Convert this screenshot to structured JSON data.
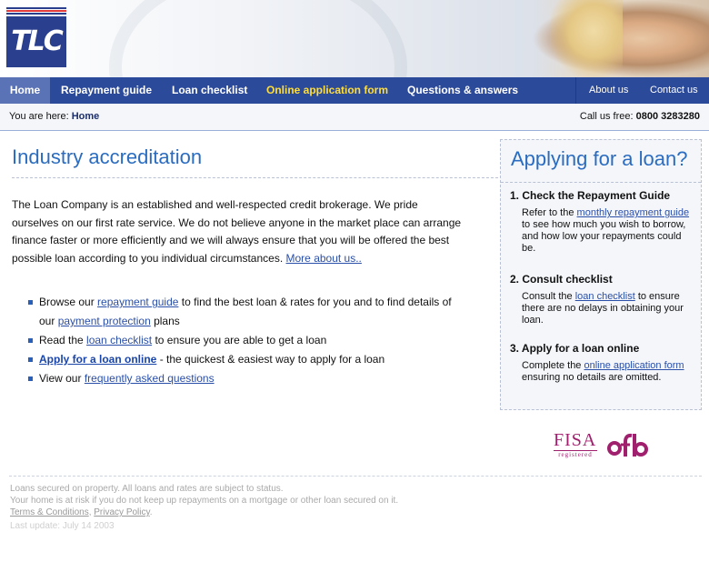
{
  "header": {
    "logo_text": "TLC",
    "logo_stripe_colors": [
      "#2a3f8e",
      "#e23b3b",
      "#2a3f8e"
    ]
  },
  "nav": {
    "home": "Home",
    "repayment": "Repayment guide",
    "checklist": "Loan checklist",
    "online": "Online application form",
    "qa": "Questions & answers",
    "about": "About us",
    "contact": "Contact us"
  },
  "breadcrumb": {
    "prefix": "You are here:",
    "current": "Home"
  },
  "call": {
    "label": "Call us free:",
    "number": "0800 3283280"
  },
  "main": {
    "title": "Industry accreditation",
    "intro": "The Loan Company is an established and well-respected credit brokerage. We pride ourselves on our first rate service. We do not believe anyone in the market place can arrange finance faster or more efficiently and we will always ensure that you will be offered the best possible loan according to you individual circumstances.",
    "more_link": "More about us..",
    "bullets": {
      "b1_pre": "Browse our",
      "b1_link1": "repayment guide",
      "b1_mid": "to find the best loan & rates for you and to find details of our",
      "b1_link2": "payment protection",
      "b1_post": "plans",
      "b2_pre": "Read the",
      "b2_link": "loan checklist",
      "b2_post": "to ensure you are able to get a loan",
      "b3_link": "Apply for a loan online",
      "b3_post": "- the quickest & easiest way to apply for a loan",
      "b4_pre": "View our",
      "b4_link": "frequently asked questions"
    }
  },
  "sidebar": {
    "title": "Applying for a loan?",
    "steps": [
      {
        "num": "1.",
        "heading": "Check the Repayment Guide",
        "pre": "Refer to the",
        "link": "monthly repayment guide",
        "post": "to see how much you wish to borrow, and how low your repayments could be."
      },
      {
        "num": "2.",
        "heading": "Consult checklist",
        "pre": "Consult the",
        "link": "loan checklist",
        "post": "to ensure there are no delays in obtaining your loan."
      },
      {
        "num": "3.",
        "heading": "Apply for a loan online",
        "pre": "Complete the",
        "link": "online application form",
        "post": "ensuring no details are omitted."
      }
    ]
  },
  "badges": {
    "fisa_big": "FISA",
    "fisa_small": "registered",
    "ofb": "ofb",
    "accent": "#a0206e"
  },
  "footer": {
    "line1": "Loans secured on property. All loans and rates are subject to status.",
    "line2": "Your home is at risk if you do not keep up repayments on a mortgage or other loan secured on it.",
    "terms": "Terms & Conditions",
    "privacy": "Privacy Policy",
    "updated": "Last update: July 14 2003"
  },
  "colors": {
    "nav_bg": "#2c4a9a",
    "nav_highlight": "#ffde3a",
    "heading_blue": "#2a6cc0",
    "link_blue": "#2a4fa8"
  }
}
